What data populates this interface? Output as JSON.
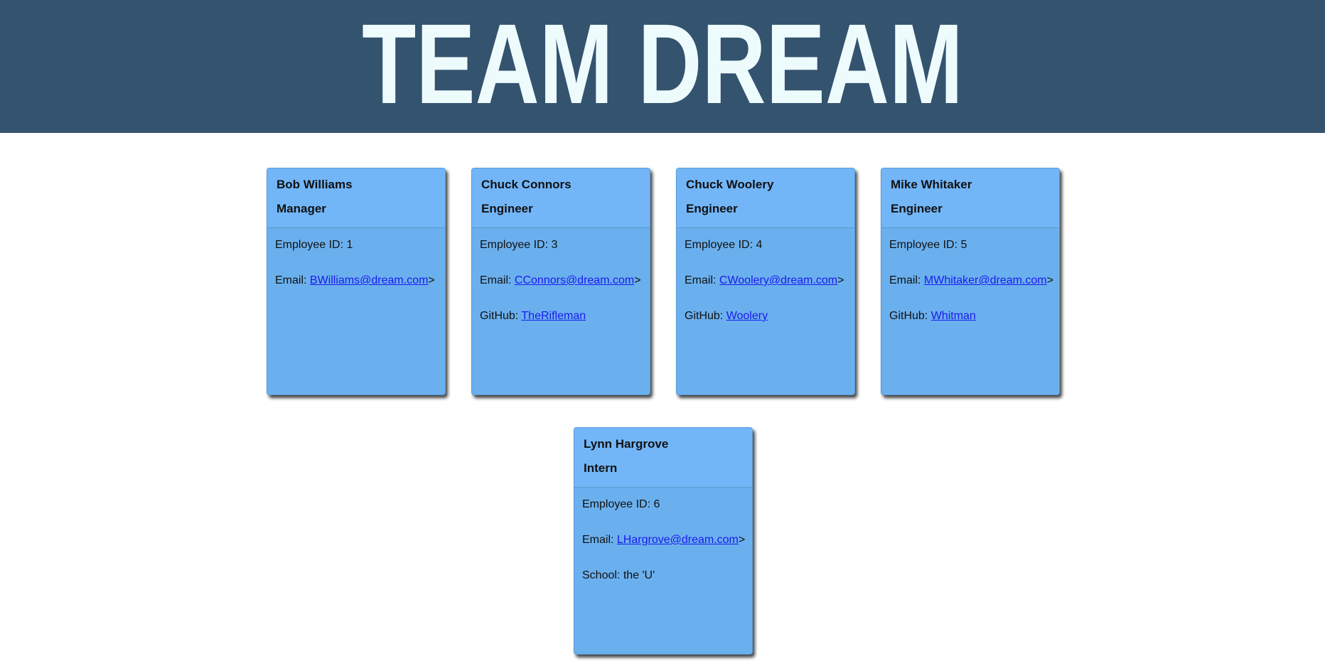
{
  "header": {
    "title": "TEAM DREAM"
  },
  "employees": [
    {
      "name": "Bob Williams",
      "role": "Manager",
      "id_label": "Employee ID: 1",
      "email_prefix": "Email: ",
      "email": "BWilliams@dream.com",
      "email_suffix": ">"
    },
    {
      "name": "Chuck Connors",
      "role": "Engineer",
      "id_label": "Employee ID: 3",
      "email_prefix": "Email: ",
      "email": "CConnors@dream.com",
      "email_suffix": ">",
      "extra_prefix": "GitHub: ",
      "extra_link": "TheRifleman"
    },
    {
      "name": "Chuck Woolery",
      "role": "Engineer",
      "id_label": "Employee ID: 4",
      "email_prefix": "Email: ",
      "email": "CWoolery@dream.com",
      "email_suffix": ">",
      "extra_prefix": "GitHub: ",
      "extra_link": "Woolery"
    },
    {
      "name": "Mike Whitaker",
      "role": "Engineer",
      "id_label": "Employee ID: 5",
      "email_prefix": "Email: ",
      "email": "MWhitaker@dream.com",
      "email_suffix": ">",
      "extra_prefix": "GitHub: ",
      "extra_link": "Whitman"
    },
    {
      "name": "Lynn Hargrove",
      "role": "Intern",
      "id_label": "Employee ID: 6",
      "email_prefix": "Email: ",
      "email": "LHargrove@dream.com",
      "email_suffix": ">",
      "extra_text": "School: the 'U'"
    }
  ],
  "colors": {
    "banner": "#33536f",
    "title": "#eefbfd",
    "card_body": "#6bb0ee",
    "card_header": "#72b6f8",
    "link": "#1a1aee"
  }
}
